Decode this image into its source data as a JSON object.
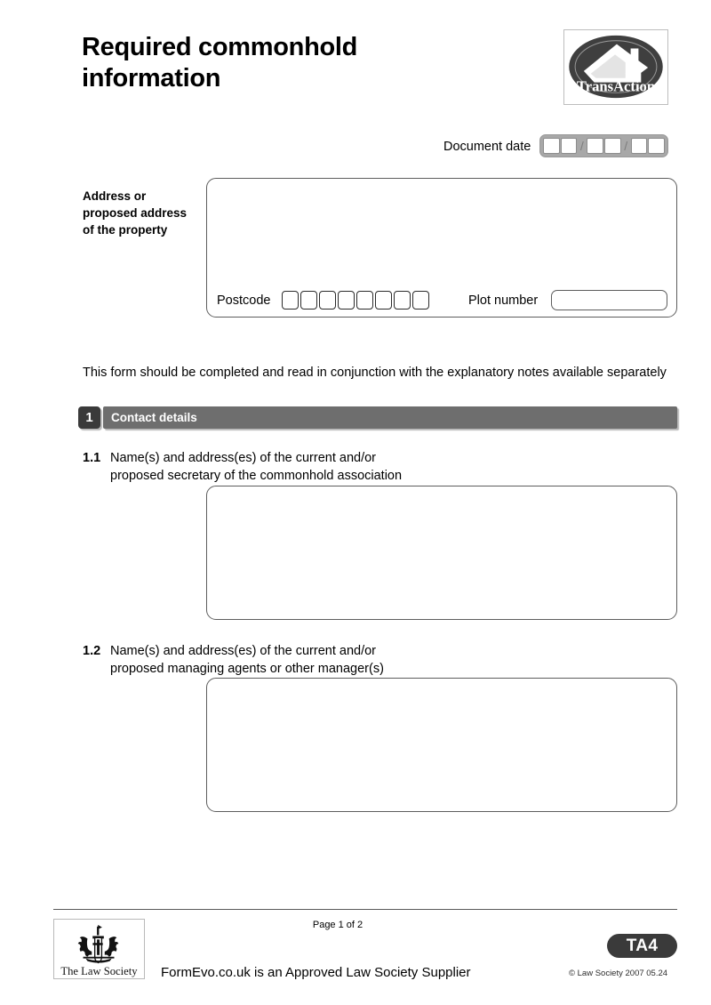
{
  "document": {
    "title_line1": "Required commonhold",
    "title_line2": "information"
  },
  "logo": {
    "name": "transaction-logo",
    "text": "TransAction"
  },
  "document_date": {
    "label": "Document date",
    "cells": [
      "",
      "",
      "",
      "",
      "",
      ""
    ],
    "separator": "/"
  },
  "address": {
    "label_line1": "Address or",
    "label_line2": "proposed address",
    "label_line3": "of the property",
    "value": "",
    "postcode_label": "Postcode",
    "postcode_cells": [
      "",
      "",
      "",
      "",
      "",
      "",
      "",
      ""
    ],
    "plot_label": "Plot number",
    "plot_value": ""
  },
  "instruction": "This form should be completed and read in conjunction with the explanatory notes available separately",
  "section": {
    "number": "1",
    "title": "Contact details"
  },
  "questions": [
    {
      "number": "1.1",
      "line1": "Name(s) and address(es) of the current and/or",
      "line2": "proposed secretary of the commonhold association",
      "answer": ""
    },
    {
      "number": "1.2",
      "line1": "Name(s) and address(es) of the current and/or",
      "line2": "proposed managing agents or other manager(s)",
      "answer": ""
    }
  ],
  "footer": {
    "law_society_name": "The Law Society",
    "page_number": "Page 1 of 2",
    "supplier": "FormEvo.co.uk is an Approved Law Society Supplier",
    "form_code": "TA4",
    "copyright": "© Law Society 2007  05.24"
  },
  "colors": {
    "section_bar": "#6e6e6e",
    "section_badge": "#3a3a3a",
    "date_field": "#a8a8a8",
    "border": "#5d5d5d"
  }
}
